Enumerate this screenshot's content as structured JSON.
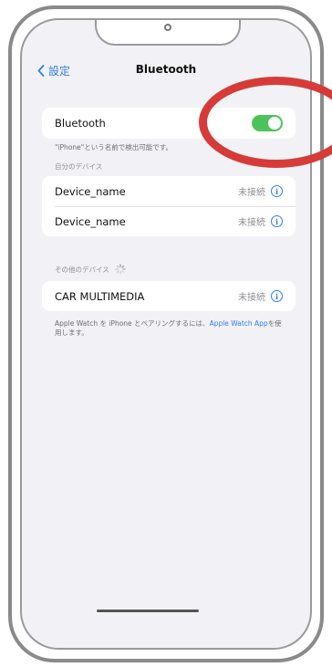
{
  "nav": {
    "back_label": "設定",
    "title": "Bluetooth"
  },
  "bluetooth": {
    "label": "Bluetooth",
    "enabled": true,
    "footnote": "\"iPhone\"という名前で検出可能です。"
  },
  "my_devices": {
    "header": "自分のデバイス",
    "items": [
      {
        "name": "Device_name",
        "status": "未接続"
      },
      {
        "name": "Device_name",
        "status": "未接続"
      }
    ]
  },
  "other_devices": {
    "header": "その他のデバイス",
    "items": [
      {
        "name": "CAR MULTIMEDIA",
        "status": "未接続"
      }
    ],
    "footer_text": "Apple Watch を iPhone とペアリングするには、",
    "footer_link": "Apple Watch App",
    "footer_suffix": "を使用します。"
  },
  "colors": {
    "accent": "#2f7cf6",
    "toggle_on": "#4cc35a",
    "highlight": "#d63b39"
  },
  "icons": {
    "back": "chevron-left-icon",
    "info": "info-icon",
    "spinner": "spinner-icon"
  }
}
